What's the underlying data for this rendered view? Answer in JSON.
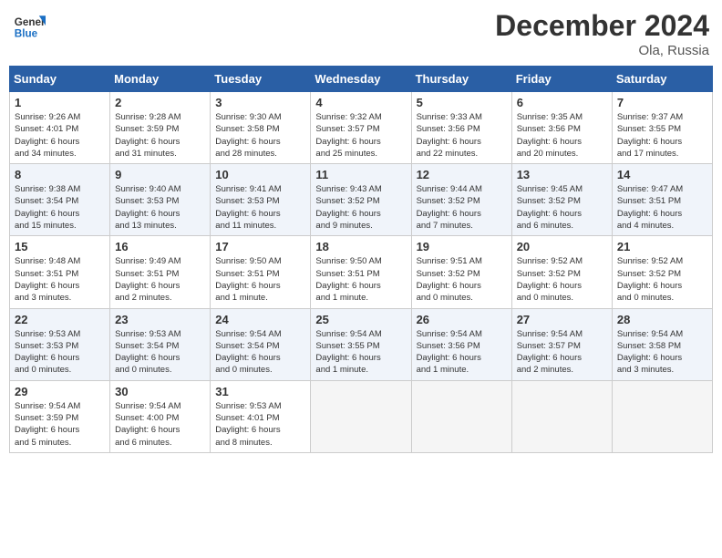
{
  "header": {
    "logo_line1": "General",
    "logo_line2": "Blue",
    "month": "December 2024",
    "location": "Ola, Russia"
  },
  "weekdays": [
    "Sunday",
    "Monday",
    "Tuesday",
    "Wednesday",
    "Thursday",
    "Friday",
    "Saturday"
  ],
  "weeks": [
    [
      {
        "day": "1",
        "info": "Sunrise: 9:26 AM\nSunset: 4:01 PM\nDaylight: 6 hours\nand 34 minutes."
      },
      {
        "day": "2",
        "info": "Sunrise: 9:28 AM\nSunset: 3:59 PM\nDaylight: 6 hours\nand 31 minutes."
      },
      {
        "day": "3",
        "info": "Sunrise: 9:30 AM\nSunset: 3:58 PM\nDaylight: 6 hours\nand 28 minutes."
      },
      {
        "day": "4",
        "info": "Sunrise: 9:32 AM\nSunset: 3:57 PM\nDaylight: 6 hours\nand 25 minutes."
      },
      {
        "day": "5",
        "info": "Sunrise: 9:33 AM\nSunset: 3:56 PM\nDaylight: 6 hours\nand 22 minutes."
      },
      {
        "day": "6",
        "info": "Sunrise: 9:35 AM\nSunset: 3:56 PM\nDaylight: 6 hours\nand 20 minutes."
      },
      {
        "day": "7",
        "info": "Sunrise: 9:37 AM\nSunset: 3:55 PM\nDaylight: 6 hours\nand 17 minutes."
      }
    ],
    [
      {
        "day": "8",
        "info": "Sunrise: 9:38 AM\nSunset: 3:54 PM\nDaylight: 6 hours\nand 15 minutes."
      },
      {
        "day": "9",
        "info": "Sunrise: 9:40 AM\nSunset: 3:53 PM\nDaylight: 6 hours\nand 13 minutes."
      },
      {
        "day": "10",
        "info": "Sunrise: 9:41 AM\nSunset: 3:53 PM\nDaylight: 6 hours\nand 11 minutes."
      },
      {
        "day": "11",
        "info": "Sunrise: 9:43 AM\nSunset: 3:52 PM\nDaylight: 6 hours\nand 9 minutes."
      },
      {
        "day": "12",
        "info": "Sunrise: 9:44 AM\nSunset: 3:52 PM\nDaylight: 6 hours\nand 7 minutes."
      },
      {
        "day": "13",
        "info": "Sunrise: 9:45 AM\nSunset: 3:52 PM\nDaylight: 6 hours\nand 6 minutes."
      },
      {
        "day": "14",
        "info": "Sunrise: 9:47 AM\nSunset: 3:51 PM\nDaylight: 6 hours\nand 4 minutes."
      }
    ],
    [
      {
        "day": "15",
        "info": "Sunrise: 9:48 AM\nSunset: 3:51 PM\nDaylight: 6 hours\nand 3 minutes."
      },
      {
        "day": "16",
        "info": "Sunrise: 9:49 AM\nSunset: 3:51 PM\nDaylight: 6 hours\nand 2 minutes."
      },
      {
        "day": "17",
        "info": "Sunrise: 9:50 AM\nSunset: 3:51 PM\nDaylight: 6 hours\nand 1 minute."
      },
      {
        "day": "18",
        "info": "Sunrise: 9:50 AM\nSunset: 3:51 PM\nDaylight: 6 hours\nand 1 minute."
      },
      {
        "day": "19",
        "info": "Sunrise: 9:51 AM\nSunset: 3:52 PM\nDaylight: 6 hours\nand 0 minutes."
      },
      {
        "day": "20",
        "info": "Sunrise: 9:52 AM\nSunset: 3:52 PM\nDaylight: 6 hours\nand 0 minutes."
      },
      {
        "day": "21",
        "info": "Sunrise: 9:52 AM\nSunset: 3:52 PM\nDaylight: 6 hours\nand 0 minutes."
      }
    ],
    [
      {
        "day": "22",
        "info": "Sunrise: 9:53 AM\nSunset: 3:53 PM\nDaylight: 6 hours\nand 0 minutes."
      },
      {
        "day": "23",
        "info": "Sunrise: 9:53 AM\nSunset: 3:54 PM\nDaylight: 6 hours\nand 0 minutes."
      },
      {
        "day": "24",
        "info": "Sunrise: 9:54 AM\nSunset: 3:54 PM\nDaylight: 6 hours\nand 0 minutes."
      },
      {
        "day": "25",
        "info": "Sunrise: 9:54 AM\nSunset: 3:55 PM\nDaylight: 6 hours\nand 1 minute."
      },
      {
        "day": "26",
        "info": "Sunrise: 9:54 AM\nSunset: 3:56 PM\nDaylight: 6 hours\nand 1 minute."
      },
      {
        "day": "27",
        "info": "Sunrise: 9:54 AM\nSunset: 3:57 PM\nDaylight: 6 hours\nand 2 minutes."
      },
      {
        "day": "28",
        "info": "Sunrise: 9:54 AM\nSunset: 3:58 PM\nDaylight: 6 hours\nand 3 minutes."
      }
    ],
    [
      {
        "day": "29",
        "info": "Sunrise: 9:54 AM\nSunset: 3:59 PM\nDaylight: 6 hours\nand 5 minutes."
      },
      {
        "day": "30",
        "info": "Sunrise: 9:54 AM\nSunset: 4:00 PM\nDaylight: 6 hours\nand 6 minutes."
      },
      {
        "day": "31",
        "info": "Sunrise: 9:53 AM\nSunset: 4:01 PM\nDaylight: 6 hours\nand 8 minutes."
      },
      {
        "day": "",
        "info": ""
      },
      {
        "day": "",
        "info": ""
      },
      {
        "day": "",
        "info": ""
      },
      {
        "day": "",
        "info": ""
      }
    ]
  ]
}
